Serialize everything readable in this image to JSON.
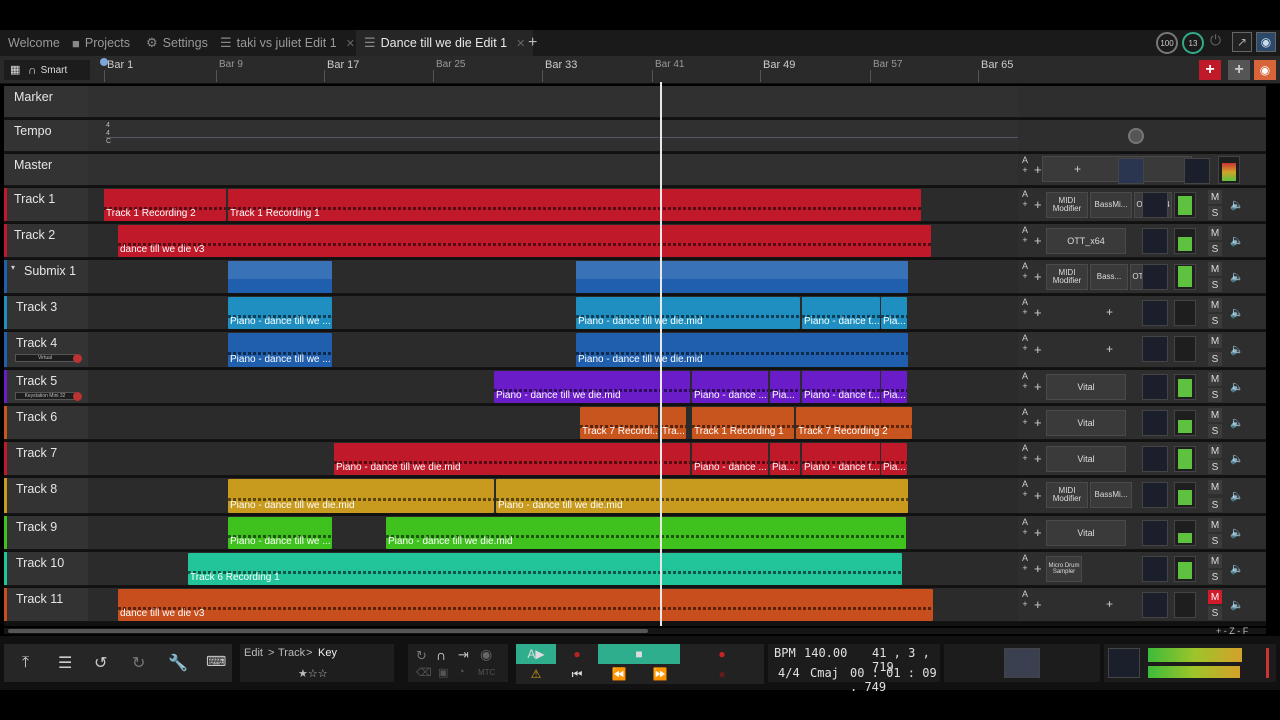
{
  "tabs": {
    "welcome": "Welcome",
    "projects": "Projects",
    "settings": "Settings",
    "edit1": "taki vs juliet Edit 1",
    "edit2": "Dance till we die Edit 1",
    "add": "+"
  },
  "top_right": {
    "cpu": "100",
    "dsp": "13"
  },
  "ruler": {
    "mode": "Smart",
    "bars": [
      "Bar 1",
      "Bar 9",
      "Bar 17",
      "Bar 25",
      "Bar 33",
      "Bar 41",
      "Bar 49",
      "Bar 57",
      "Bar 65"
    ]
  },
  "colors": {
    "red": "#c0192a",
    "blue": "#1f5fae",
    "cyan": "#1e8fc0",
    "purple": "#6a1cc8",
    "orange": "#c8541e",
    "gold": "#c89a1e",
    "green": "#3fc21e",
    "teal": "#22c49a",
    "rust": "#c84e1e"
  },
  "tracks": [
    {
      "name": "Marker"
    },
    {
      "name": "Tempo",
      "sig": [
        "4",
        "4",
        "C"
      ]
    },
    {
      "name": "Master"
    },
    {
      "name": "Track 1",
      "clips": [
        "Track 1 Recording 2",
        "Track 1 Recording 1"
      ],
      "plugins": [
        "MIDI Modifier",
        "BassMi...",
        "OTT_x64"
      ]
    },
    {
      "name": "Track 2",
      "clips": [
        "dance till we die v3"
      ],
      "plugins": [
        "OTT_x64"
      ]
    },
    {
      "name": "Submix 1",
      "plugins": [
        "MIDI Modifier",
        "Bass...",
        "OTT_x64"
      ]
    },
    {
      "name": "Track 3",
      "clips": [
        "Piano - dance till we ...",
        "Piano - dance till we die.mid",
        "Piano - dance t...",
        "Pia..."
      ]
    },
    {
      "name": "Track 4",
      "input": "Virtual",
      "clips": [
        "Piano - dance till we ...",
        "Piano - dance till we die.mid"
      ]
    },
    {
      "name": "Track 5",
      "input": "Keystation Mini 32",
      "clips": [
        "Piano - dance till we die.mid",
        "Piano - dance ...",
        "Pia...",
        "Piano - dance t...",
        "Pia..."
      ],
      "plugins": [
        "Vital"
      ]
    },
    {
      "name": "Track 6",
      "clips": [
        "Track 7 Recordi...",
        "Tra...",
        "Track 1 Recording 1",
        "Track 7 Recording 2"
      ],
      "plugins": [
        "Vital"
      ]
    },
    {
      "name": "Track 7",
      "clips": [
        "Piano - dance till we die.mid",
        "Piano - dance ...",
        "Pia...",
        "Piano - dance t...",
        "Pia..."
      ],
      "plugins": [
        "Vital"
      ]
    },
    {
      "name": "Track 8",
      "clips": [
        "Piano - dance till we die.mid",
        "Piano - dance till we die.mid"
      ],
      "plugins": [
        "MIDI Modifier",
        "BassMi..."
      ]
    },
    {
      "name": "Track 9",
      "clips": [
        "Piano - dance till we ...",
        "Piano - dance till we die.mid"
      ],
      "plugins": [
        "Vital"
      ]
    },
    {
      "name": "Track 10",
      "clips": [
        "Track 6 Recording 1"
      ],
      "plugins": [
        "Micro Drum Sampler"
      ]
    },
    {
      "name": "Track 11",
      "clips": [
        "dance till we die v3"
      ]
    }
  ],
  "row_labels": {
    "a": "A",
    "m": "M",
    "s": "S",
    "plus": "+"
  },
  "bottom": {
    "breadcrumb": [
      "Edit",
      "Track",
      "Key"
    ],
    "sep": ">",
    "mtc": "MTC",
    "bpm_label": "BPM",
    "bpm": "140.00",
    "position": "41 , 3 , 719",
    "timesig": "4/4",
    "key": "Cmaj",
    "time": "00 : 01 : 09 . 749"
  },
  "zoom_controls": "+ - Z - F"
}
